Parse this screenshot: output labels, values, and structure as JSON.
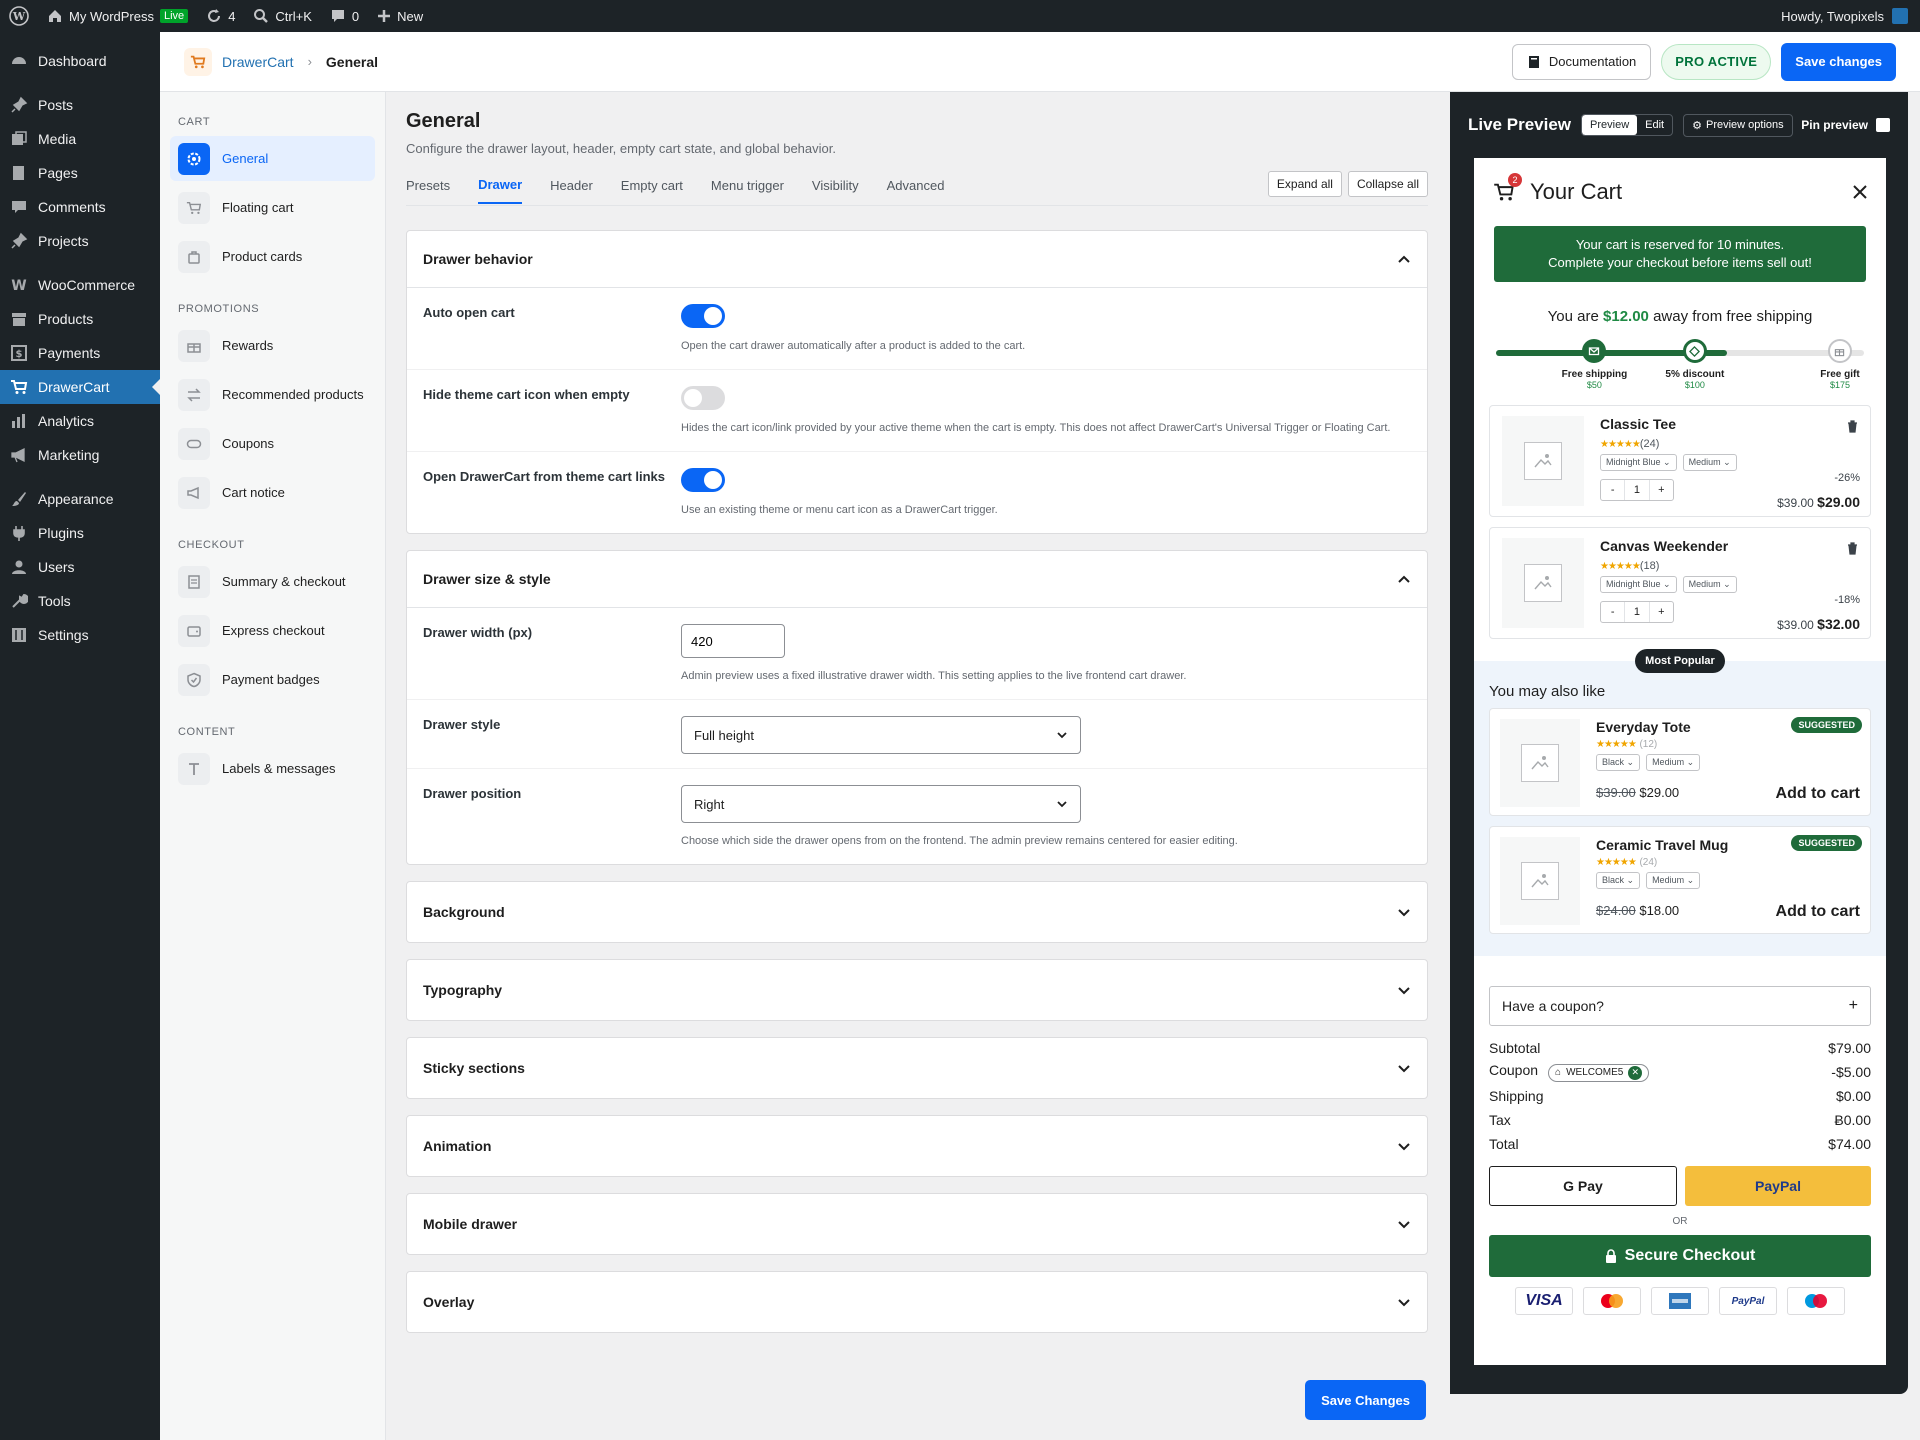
{
  "admin_bar": {
    "site": "My WordPress",
    "live": "Live",
    "updates": "4",
    "search": "Ctrl+K",
    "comments": "0",
    "new": "New",
    "howdy": "Howdy, Twopixels"
  },
  "sidebar": {
    "items": [
      {
        "label": "Dashboard",
        "icon": "dashboard-icon"
      },
      {
        "label": "Posts",
        "icon": "pin-icon"
      },
      {
        "label": "Media",
        "icon": "media-icon"
      },
      {
        "label": "Pages",
        "icon": "pages-icon"
      },
      {
        "label": "Comments",
        "icon": "comment-icon"
      },
      {
        "label": "Projects",
        "icon": "pin-icon"
      },
      {
        "label": "WooCommerce",
        "icon": "woo-icon"
      },
      {
        "label": "Products",
        "icon": "archive-icon"
      },
      {
        "label": "Payments",
        "icon": "dollar-icon"
      },
      {
        "label": "DrawerCart",
        "icon": "cart-icon"
      },
      {
        "label": "Analytics",
        "icon": "chart-icon"
      },
      {
        "label": "Marketing",
        "icon": "megaphone-icon"
      },
      {
        "label": "Appearance",
        "icon": "brush-icon"
      },
      {
        "label": "Plugins",
        "icon": "plug-icon"
      },
      {
        "label": "Users",
        "icon": "user-icon"
      },
      {
        "label": "Tools",
        "icon": "wrench-icon"
      },
      {
        "label": "Settings",
        "icon": "sliders-icon"
      }
    ]
  },
  "topbar": {
    "breadcrumb_root": "DrawerCart",
    "breadcrumb_current": "General",
    "documentation": "Documentation",
    "pro_badge": "PRO ACTIVE",
    "save": "Save changes"
  },
  "subnav": {
    "cart_title": "CART",
    "cart": [
      "General",
      "Floating cart",
      "Product cards"
    ],
    "promotions_title": "PROMOTIONS",
    "promotions": [
      "Rewards",
      "Recommended products",
      "Coupons",
      "Cart notice"
    ],
    "checkout_title": "CHECKOUT",
    "checkout": [
      "Summary & checkout",
      "Express checkout",
      "Payment badges"
    ],
    "content_title": "CONTENT",
    "content": [
      "Labels & messages"
    ]
  },
  "page": {
    "title": "General",
    "description": "Configure the drawer layout, header, empty cart state, and global behavior.",
    "tabs": [
      "Presets",
      "Drawer",
      "Header",
      "Empty cart",
      "Menu trigger",
      "Visibility",
      "Advanced"
    ],
    "expand_all": "Expand all",
    "collapse_all": "Collapse all",
    "save_bottom": "Save Changes"
  },
  "drawer_behavior": {
    "title": "Drawer behavior",
    "auto_open": {
      "label": "Auto open cart",
      "on": true,
      "help": "Open the cart drawer automatically after a product is added to the cart."
    },
    "hide_icon": {
      "label": "Hide theme cart icon when empty",
      "on": false,
      "help": "Hides the cart icon/link provided by your active theme when the cart is empty. This does not affect DrawerCart's Universal Trigger or Floating Cart."
    },
    "open_links": {
      "label": "Open DrawerCart from theme cart links",
      "on": true,
      "help": "Use an existing theme or menu cart icon as a DrawerCart trigger."
    }
  },
  "drawer_size": {
    "title": "Drawer size & style",
    "width": {
      "label": "Drawer width (px)",
      "value": "420",
      "help": "Admin preview uses a fixed illustrative drawer width. This setting applies to the live frontend cart drawer."
    },
    "style": {
      "label": "Drawer style",
      "value": "Full height"
    },
    "position": {
      "label": "Drawer position",
      "value": "Right",
      "help": "Choose which side the drawer opens from on the frontend. The admin preview remains centered for easier editing."
    }
  },
  "collapsed_sections": [
    "Background",
    "Typography",
    "Sticky sections",
    "Animation",
    "Mobile drawer",
    "Overlay"
  ],
  "preview": {
    "title": "Live Preview",
    "mode_preview": "Preview",
    "mode_edit": "Edit",
    "options": "Preview options",
    "pin": "Pin preview",
    "cart_title": "Your Cart",
    "cart_count": "2",
    "reserve_line1": "Your cart is reserved for 10 minutes.",
    "reserve_line2": "Complete your checkout before items sell out!",
    "ship_prefix": "You are",
    "ship_amount": "$12.00",
    "ship_suffix": "away from free shipping",
    "progress_fraction": 0.62,
    "milestones": [
      {
        "label": "Free shipping",
        "value": "$50",
        "state": "done",
        "pos": 0.27
      },
      {
        "label": "5% discount",
        "value": "$100",
        "state": "current",
        "pos": 0.54
      },
      {
        "label": "Free gift",
        "value": "$175",
        "state": "off",
        "pos": 0.93
      }
    ],
    "items": [
      {
        "name": "Classic Tee",
        "stars": "★★★★★",
        "reviews": "(24)",
        "color": "Midnight Blue",
        "size": "Medium",
        "qty": "1",
        "discount": "-26%",
        "old": "$39.00",
        "price": "$29.00"
      },
      {
        "name": "Canvas Weekender",
        "stars": "★★★★★",
        "reviews": "(18)",
        "color": "Midnight Blue",
        "size": "Medium",
        "qty": "1",
        "discount": "-18%",
        "old": "$39.00",
        "price": "$32.00"
      }
    ],
    "popular": "Most Popular",
    "upsell_title": "You may also like",
    "upsells": [
      {
        "name": "Everyday Tote",
        "stars": "★★★★★",
        "reviews": "(12)",
        "color": "Black",
        "size": "Medium",
        "old": "$39.00",
        "price": "$29.00",
        "badge": "SUGGESTED",
        "add": "Add to cart"
      },
      {
        "name": "Ceramic Travel Mug",
        "stars": "★★★★★",
        "reviews": "(24)",
        "color": "Black",
        "size": "Medium",
        "old": "$24.00",
        "price": "$18.00",
        "badge": "SUGGESTED",
        "add": "Add to cart"
      }
    ],
    "coupon_prompt": "Have a coupon?",
    "totals": {
      "subtotal_label": "Subtotal",
      "subtotal": "$79.00",
      "coupon_label": "Coupon",
      "coupon_code": "WELCOME5",
      "coupon": "-$5.00",
      "shipping_label": "Shipping",
      "shipping": "$0.00",
      "tax_label": "Tax",
      "tax": "Ƀ0.00",
      "total_label": "Total",
      "total": "$74.00"
    },
    "gpay": "G Pay",
    "paypal": "PayPal",
    "or": "OR",
    "checkout": "Secure Checkout",
    "card_logos": [
      "VISA",
      "Mastercard",
      "AMEX",
      "PayPal",
      "Maestro"
    ]
  },
  "colors": {
    "accent": "#0a66f5",
    "admin_dark": "#1d2327",
    "wp_blue": "#2271b1",
    "green": "#1f6b3a",
    "paypal": "#f4be3c"
  }
}
